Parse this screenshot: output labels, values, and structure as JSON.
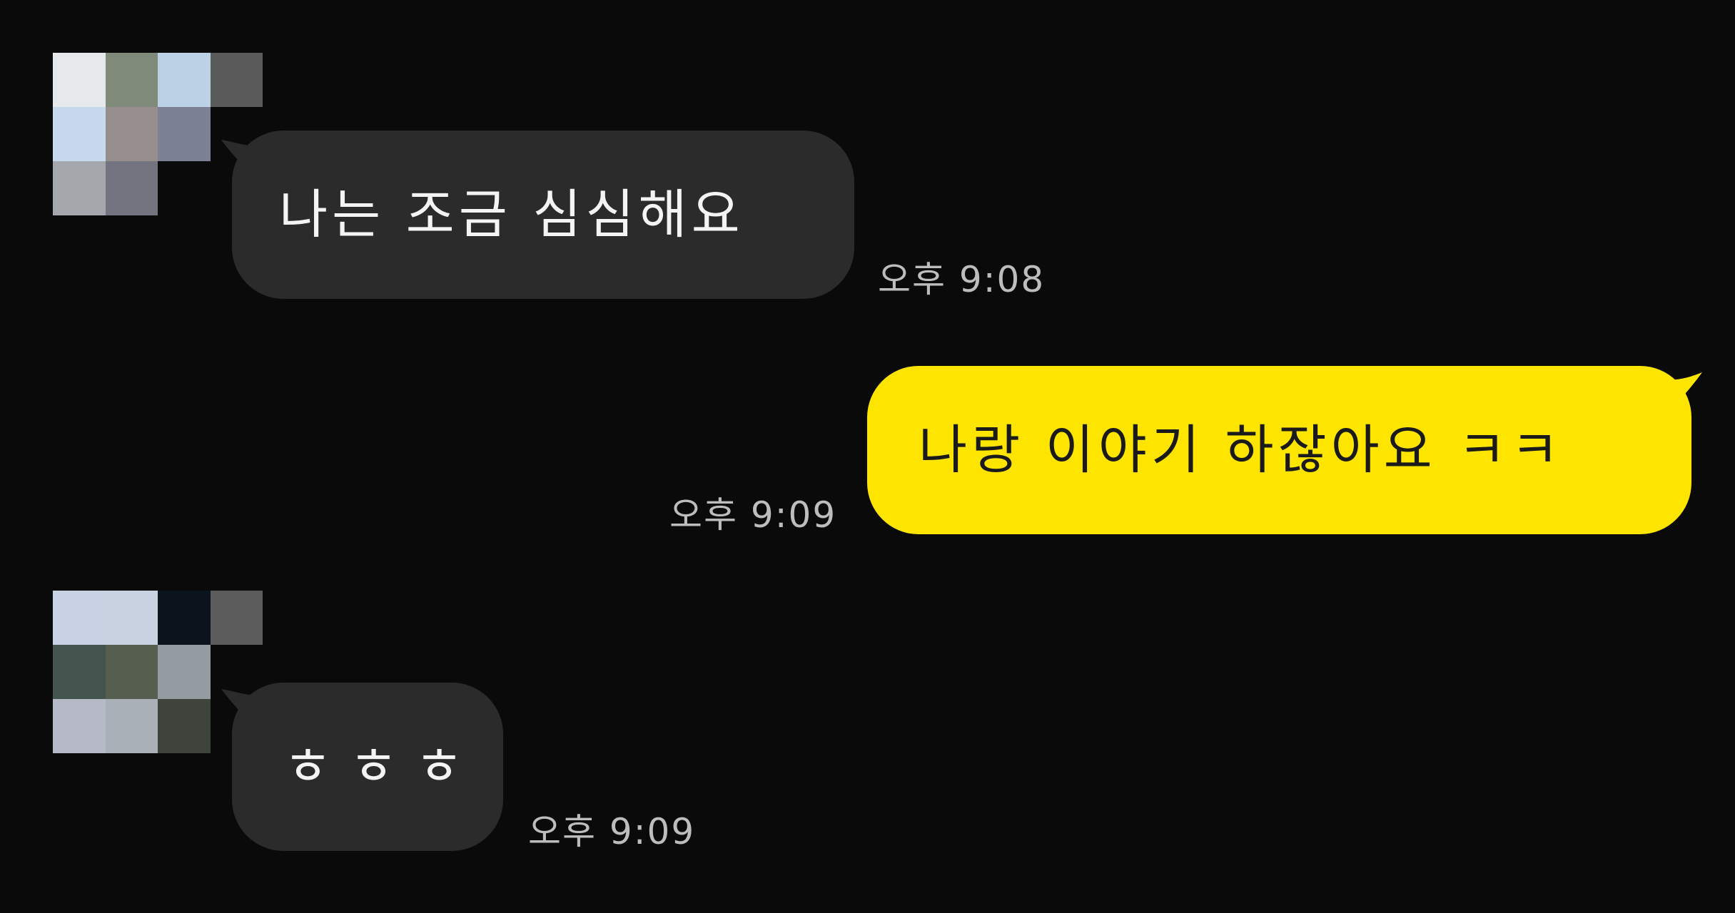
{
  "colors": {
    "background": "#0a0a0a",
    "incoming_bubble": "#2b2b2b",
    "outgoing_bubble": "#fee500",
    "timestamp": "#bdbdbd"
  },
  "messages": [
    {
      "direction": "incoming",
      "text": "나는 조금 심심해요",
      "time": "오후 9:08",
      "avatar": "blurred-avatar"
    },
    {
      "direction": "outgoing",
      "text": "나랑 이야기 하잖아요 ㅋㅋ",
      "time": "오후 9:09"
    },
    {
      "direction": "incoming",
      "text": "ㅎㅎㅎ",
      "time": "오후 9:09",
      "avatar": "blurred-avatar"
    }
  ]
}
